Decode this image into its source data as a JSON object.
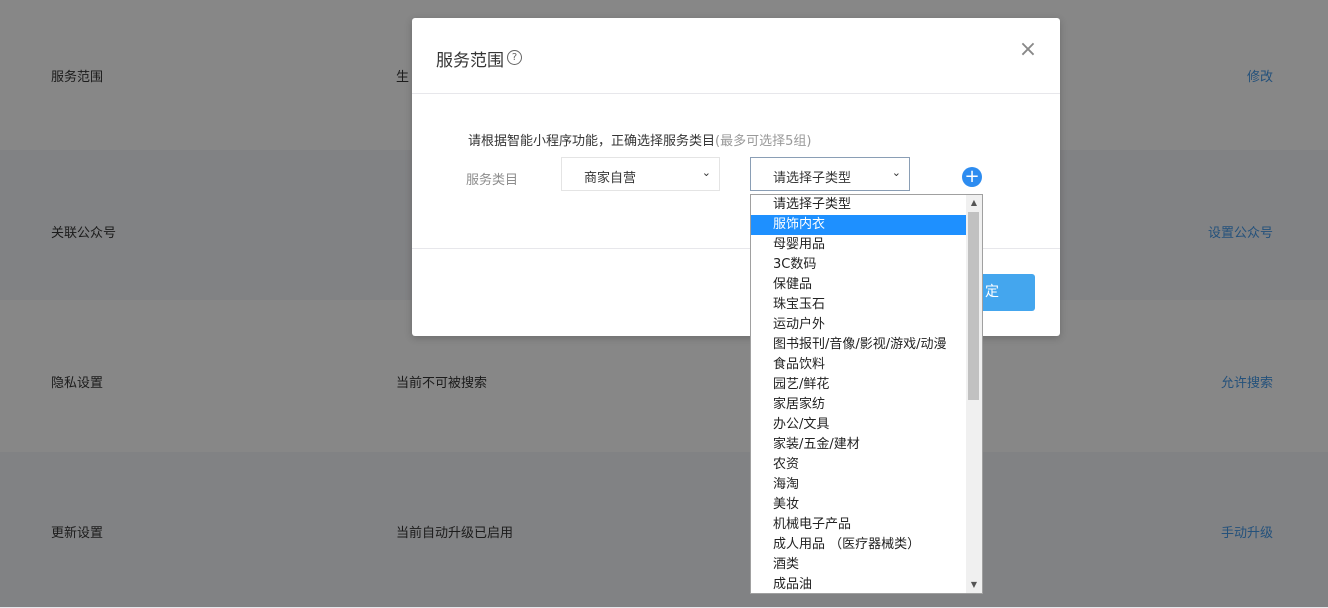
{
  "background": {
    "rows": [
      {
        "label": "服务范围",
        "value": "生",
        "action": "修改"
      },
      {
        "label": "关联公众号",
        "value": "",
        "action": "设置公众号"
      },
      {
        "label": "隐私设置",
        "value": "当前不可被搜索",
        "action": "允许搜索"
      },
      {
        "label": "更新设置",
        "value": "当前自动升级已启用",
        "action": "手动升级"
      }
    ]
  },
  "dialog": {
    "title": "服务范围",
    "help_glyph": "?",
    "close_glyph": "×",
    "hint": "请根据智能小程序功能，正确选择服务类目",
    "hint_sub": "(最多可选择5组)",
    "field_label": "服务类目",
    "category_select": {
      "value": "商家自营"
    },
    "subtype_select": {
      "value": "请选择子类型"
    },
    "add_glyph": "+",
    "ok_label": "定"
  },
  "dropdown": {
    "selected_index": 1,
    "options": [
      "请选择子类型",
      "服饰内衣",
      "母婴用品",
      "3C数码",
      "保健品",
      "珠宝玉石",
      "运动户外",
      "图书报刊/音像/影视/游戏/动漫",
      "食品饮料",
      "园艺/鲜花",
      "家居家纺",
      "办公/文具",
      "家装/五金/建材",
      "农资",
      "海淘",
      "美妆",
      "机械电子产品",
      "成人用品 （医疗器械类）",
      "酒类",
      "成品油"
    ]
  }
}
